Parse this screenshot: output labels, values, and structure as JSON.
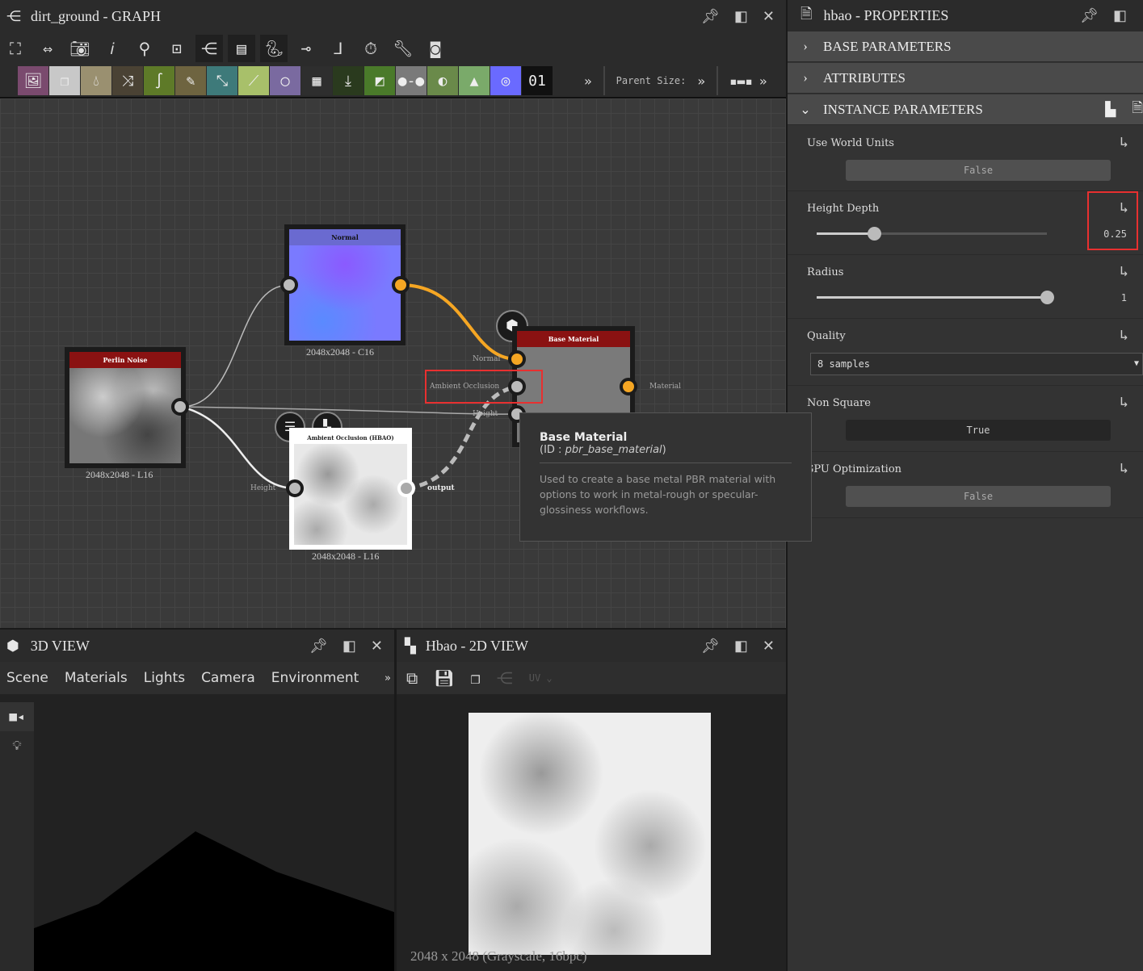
{
  "graph": {
    "title": "dirt_ground - GRAPH",
    "parent_size_label": "Parent Size:",
    "toolbar_icons": [
      "fit-view-icon",
      "reset-zoom-icon",
      "screenshot-icon",
      "info-icon",
      "search-icon",
      "frame-icon",
      "graph-icon",
      "stack-icon",
      "python-icon",
      "connector-icon",
      "route-icon",
      "timer-icon",
      "wrench-icon",
      "preview-icon"
    ],
    "swatches": [
      {
        "icon": "bitmap-icon",
        "color": "#7a4a6e"
      },
      {
        "icon": "copy-icon",
        "color": "#c8c8c8"
      },
      {
        "icon": "drop-icon",
        "color": "#9a9070"
      },
      {
        "icon": "shuffle-icon",
        "color": "#4a4234"
      },
      {
        "icon": "curve-icon",
        "color": "#5e7a28"
      },
      {
        "icon": "eyedropper-icon",
        "color": "#6e6440"
      },
      {
        "icon": "warp-icon",
        "color": "#3e7a7a"
      },
      {
        "icon": "gradient-icon",
        "color": "#a8c06a"
      },
      {
        "icon": "circle-icon",
        "color": "#7a6aa0"
      },
      {
        "icon": "tiles-icon",
        "color": "#2e2e2e"
      },
      {
        "icon": "import-icon",
        "color": "#2a3a1e"
      },
      {
        "icon": "gradient-map-icon",
        "color": "#4a7a2a"
      },
      {
        "icon": "blend-icon",
        "color": "#7a7a7a"
      },
      {
        "icon": "levels-icon",
        "color": "#6a8a4a"
      },
      {
        "icon": "histogram-icon",
        "color": "#7aaa6a"
      },
      {
        "icon": "color-wheel-icon",
        "color": "#6a6aff"
      },
      {
        "icon": "fx-map-icon",
        "color": "#111111"
      }
    ],
    "nodes": {
      "perlin": {
        "title": "Perlin Noise",
        "caption": "2048x2048 - L16"
      },
      "normal": {
        "title": "Normal",
        "caption": "2048x2048 - C16"
      },
      "ao": {
        "title": "Ambient Occlusion (HBAO)",
        "caption": "2048x2048 - L16",
        "in_label": "Height",
        "out_label": "output"
      },
      "base": {
        "title": "Base Material",
        "ports": [
          "Normal",
          "Ambient Occlusion",
          "Height"
        ],
        "out_label": "Material"
      }
    },
    "tooltip": {
      "title": "Base Material",
      "id_prefix": "(ID : ",
      "id": "pbr_base_material",
      "id_suffix": ")",
      "description": "Used to create a base metal PBR material with options to work in metal-rough or specular-glossiness workflows."
    },
    "accent": "#f5a623"
  },
  "properties": {
    "title": "hbao - PROPERTIES",
    "sections": [
      "BASE PARAMETERS",
      "ATTRIBUTES",
      "INSTANCE PARAMETERS"
    ],
    "params": {
      "use_world_units": {
        "label": "Use World Units",
        "value": "False"
      },
      "height_depth": {
        "label": "Height Depth",
        "value": "0.25",
        "fraction": 0.25
      },
      "radius": {
        "label": "Radius",
        "value": "1",
        "fraction": 1.0
      },
      "quality": {
        "label": "Quality",
        "value": "8 samples"
      },
      "non_square": {
        "label": "Non Square",
        "value": "True"
      },
      "gpu_opt": {
        "label": "GPU Optimization",
        "value": "False"
      }
    }
  },
  "view3d": {
    "title": "3D VIEW",
    "tabs": [
      "Scene",
      "Materials",
      "Lights",
      "Camera",
      "Environment"
    ]
  },
  "view2d": {
    "title": "Hbao - 2D VIEW",
    "uv_label": "UV",
    "status": "2048 x 2048 (Grayscale, 16bpc)"
  }
}
